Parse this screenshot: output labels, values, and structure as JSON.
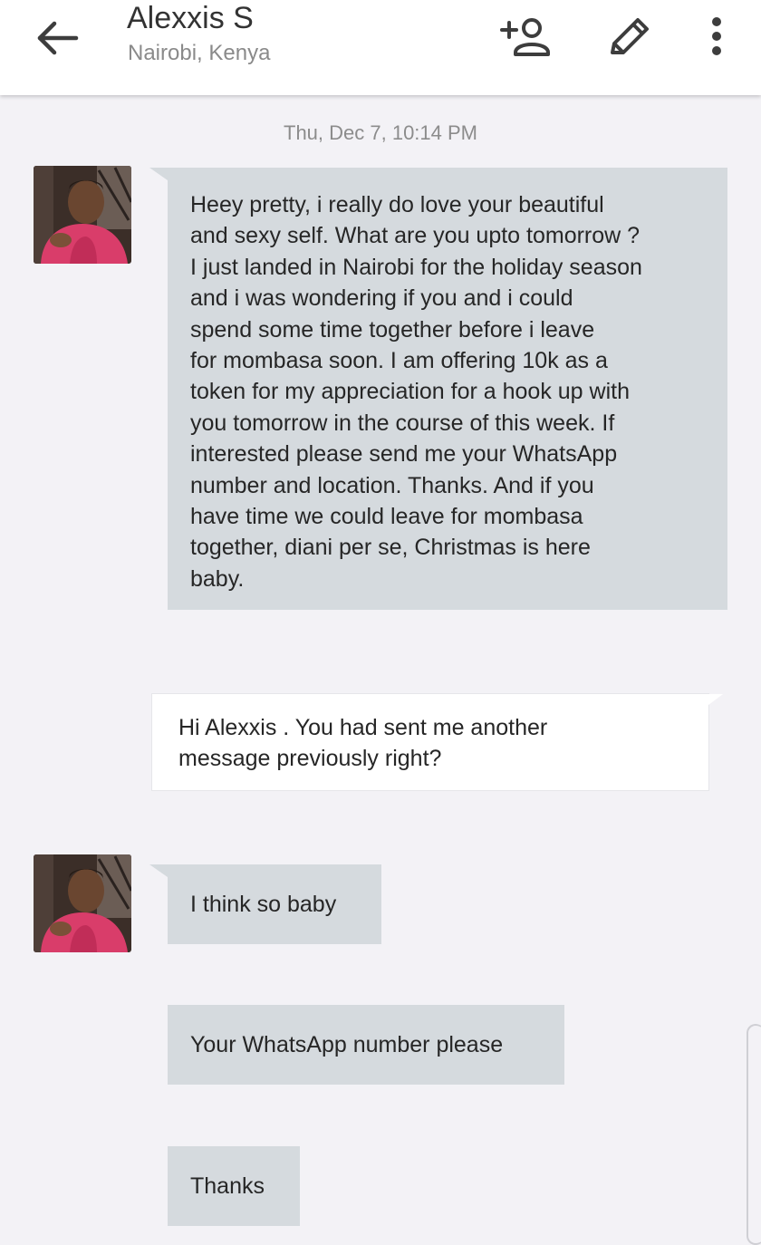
{
  "header": {
    "name": "Alexxis S",
    "location": "Nairobi, Kenya"
  },
  "icons": {
    "back": "arrow-left-icon",
    "add_contact": "person-add-icon",
    "edit": "pencil-icon",
    "more": "more-vertical-icon"
  },
  "colors": {
    "incoming_bubble": "#d5dade",
    "outgoing_bubble": "#ffffff",
    "background": "#f3f2f6"
  },
  "conversation": {
    "timestamp": "Thu, Dec 7, 10:14 PM",
    "messages": [
      {
        "direction": "incoming",
        "lines": [
          "Heey pretty, i really do love your beautiful",
          "and sexy self.  What are you upto tomorrow ?",
          "I just landed in Nairobi for the holiday season",
          "and i was wondering if you and i could",
          "spend some time together before i leave",
          "for mombasa soon. I am offering 10k as a",
          "token for my appreciation for a hook up with",
          "you tomorrow in the course of this week. If",
          "interested please send me your WhatsApp",
          "number and location.  Thanks.  And if you",
          "have time we could leave for mombasa",
          "together,  diani per se, Christmas is here",
          "baby."
        ]
      },
      {
        "direction": "outgoing",
        "lines": [
          "Hi Alexxis . You had sent me another",
          "message previously right?"
        ]
      },
      {
        "direction": "incoming",
        "lines": [
          "I think so baby"
        ]
      },
      {
        "direction": "incoming",
        "lines": [
          "Your WhatsApp number please"
        ]
      },
      {
        "direction": "incoming",
        "lines": [
          "Thanks"
        ]
      }
    ]
  }
}
